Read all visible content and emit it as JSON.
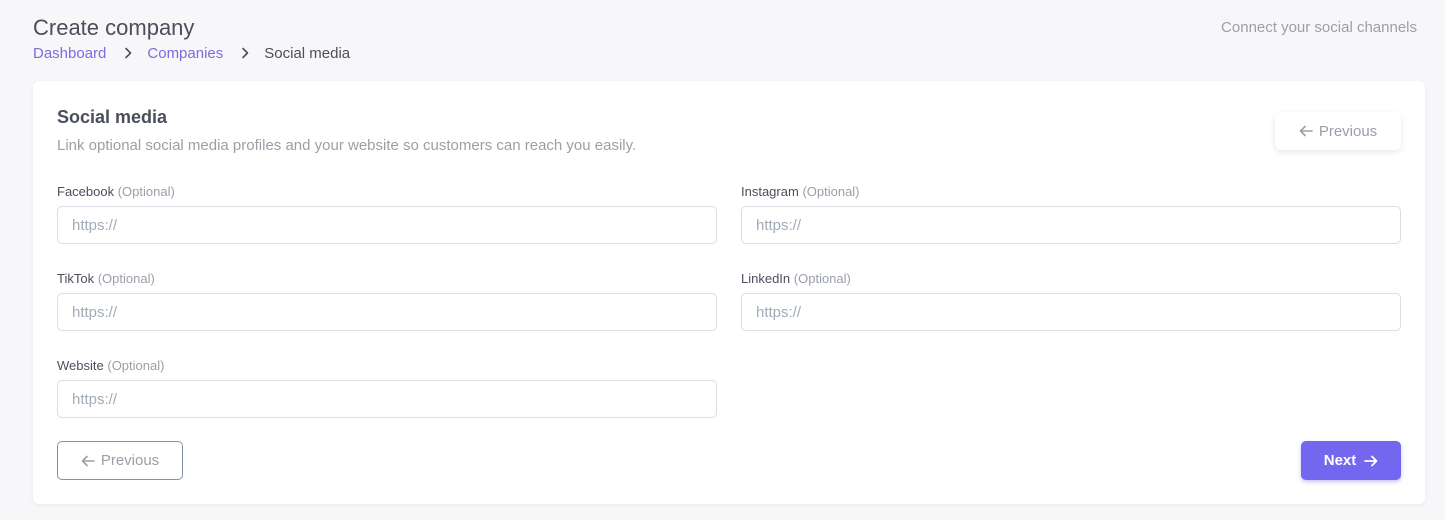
{
  "header": {
    "title": "Create company",
    "note": "Connect your social channels",
    "breadcrumb": {
      "items": [
        "Dashboard",
        "Companies"
      ],
      "current": "Social media"
    }
  },
  "card": {
    "title": "Social media",
    "subtitle": "Link optional social media profiles and your website so customers can reach you easily.",
    "top_previous_label": "Previous",
    "fields": {
      "facebook": {
        "label": "Facebook",
        "optional": "(Optional)",
        "value": "",
        "placeholder": "https://"
      },
      "instagram": {
        "label": "Instagram",
        "optional": "(Optional)",
        "value": "",
        "placeholder": "https://"
      },
      "tiktok": {
        "label": "TikTok",
        "optional": "(Optional)",
        "value": "",
        "placeholder": "https://"
      },
      "linkedin": {
        "label": "LinkedIn",
        "optional": "(Optional)",
        "value": "",
        "placeholder": "https://"
      },
      "website": {
        "label": "Website",
        "optional": "(Optional)",
        "value": "",
        "placeholder": "https://"
      }
    },
    "previous_label": "Previous",
    "next_label": "Next"
  },
  "icons": {
    "breadcrumb_separator": "chevron-right-icon",
    "previous": "arrow-left-icon",
    "next": "arrow-right-icon"
  },
  "colors": {
    "accent": "#7367f0",
    "link": "#7b6ce0",
    "background": "#f7f7f9",
    "card": "#ffffff"
  }
}
